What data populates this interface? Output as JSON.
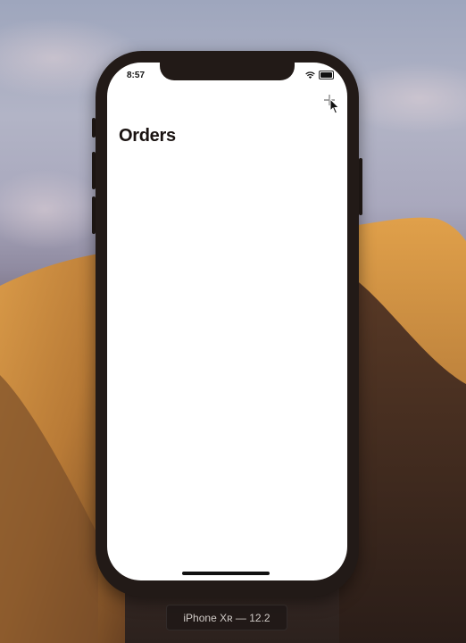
{
  "status_bar": {
    "time": "8:57",
    "wifi_icon": "wifi-icon",
    "battery_icon": "battery-icon"
  },
  "nav_bar": {
    "title": "Orders",
    "add_icon": "plus-icon"
  },
  "simulator": {
    "device_label": "iPhone Xʀ — 12.2"
  },
  "colors": {
    "screen_background": "#ffffff",
    "title_color": "#1a1311",
    "accent": "#007aff",
    "device_frame": "#221a17"
  }
}
